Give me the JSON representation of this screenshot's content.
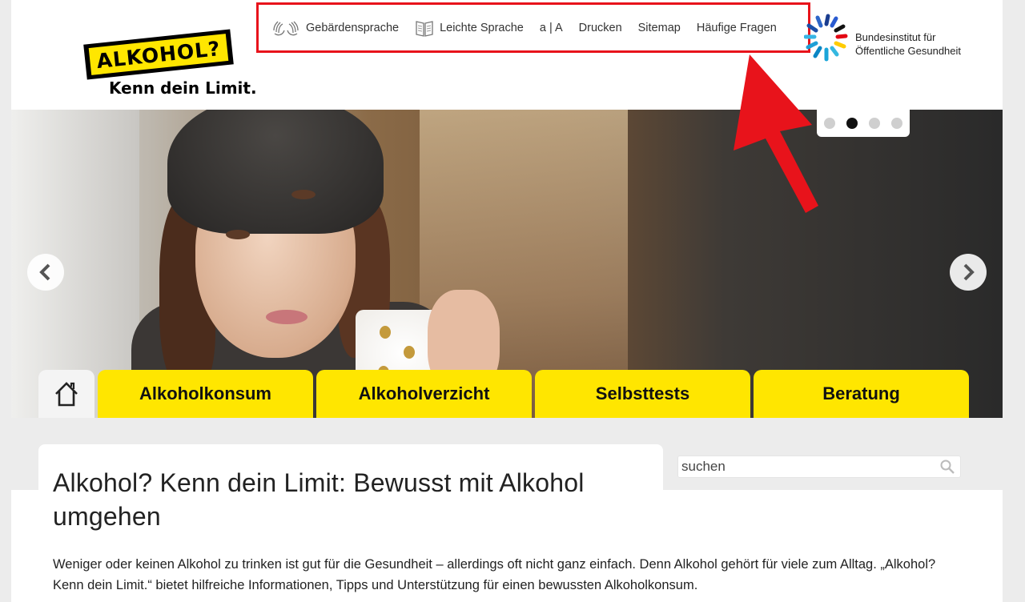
{
  "logo": {
    "tag_text": "ALKOHOL?",
    "claim_text": "Kenn dein Limit."
  },
  "servicebar": [
    {
      "label": "Gebärdensprache",
      "icon": "sign-language-icon"
    },
    {
      "label": "Leichte Sprache",
      "icon": "easy-language-book-icon"
    },
    {
      "label": "a | A",
      "icon": ""
    },
    {
      "label": "Drucken",
      "icon": ""
    },
    {
      "label": "Sitemap",
      "icon": ""
    },
    {
      "label": "Häufige Fragen",
      "icon": ""
    }
  ],
  "institute": {
    "line1": "Bundesinstitut für",
    "line2": "Öffentliche Gesundheit"
  },
  "slider": {
    "total_slides": 4,
    "active_slide": 2
  },
  "main_nav": {
    "home_icon": "home-icon",
    "items": [
      "Alkoholkonsum",
      "Alkoholverzicht",
      "Selbsttests",
      "Beratung"
    ]
  },
  "search": {
    "placeholder": "suchen",
    "value": ""
  },
  "content": {
    "title": "Alkohol? Kenn dein Limit: Bewusst mit Alkohol umgehen",
    "intro": "Weniger oder keinen Alkohol zu trinken ist gut für die Gesundheit – allerdings oft nicht ganz einfach. Denn Alkohol gehört für viele zum Alltag. „Alkohol? Kenn dein Limit.“ bietet hilfreiche Informationen, Tipps und Unterstützung für einen bewussten Alkoholkonsum."
  },
  "colors": {
    "brand_yellow": "#ffe600",
    "annotation_red": "#e8131b",
    "page_bg": "#ececec"
  }
}
